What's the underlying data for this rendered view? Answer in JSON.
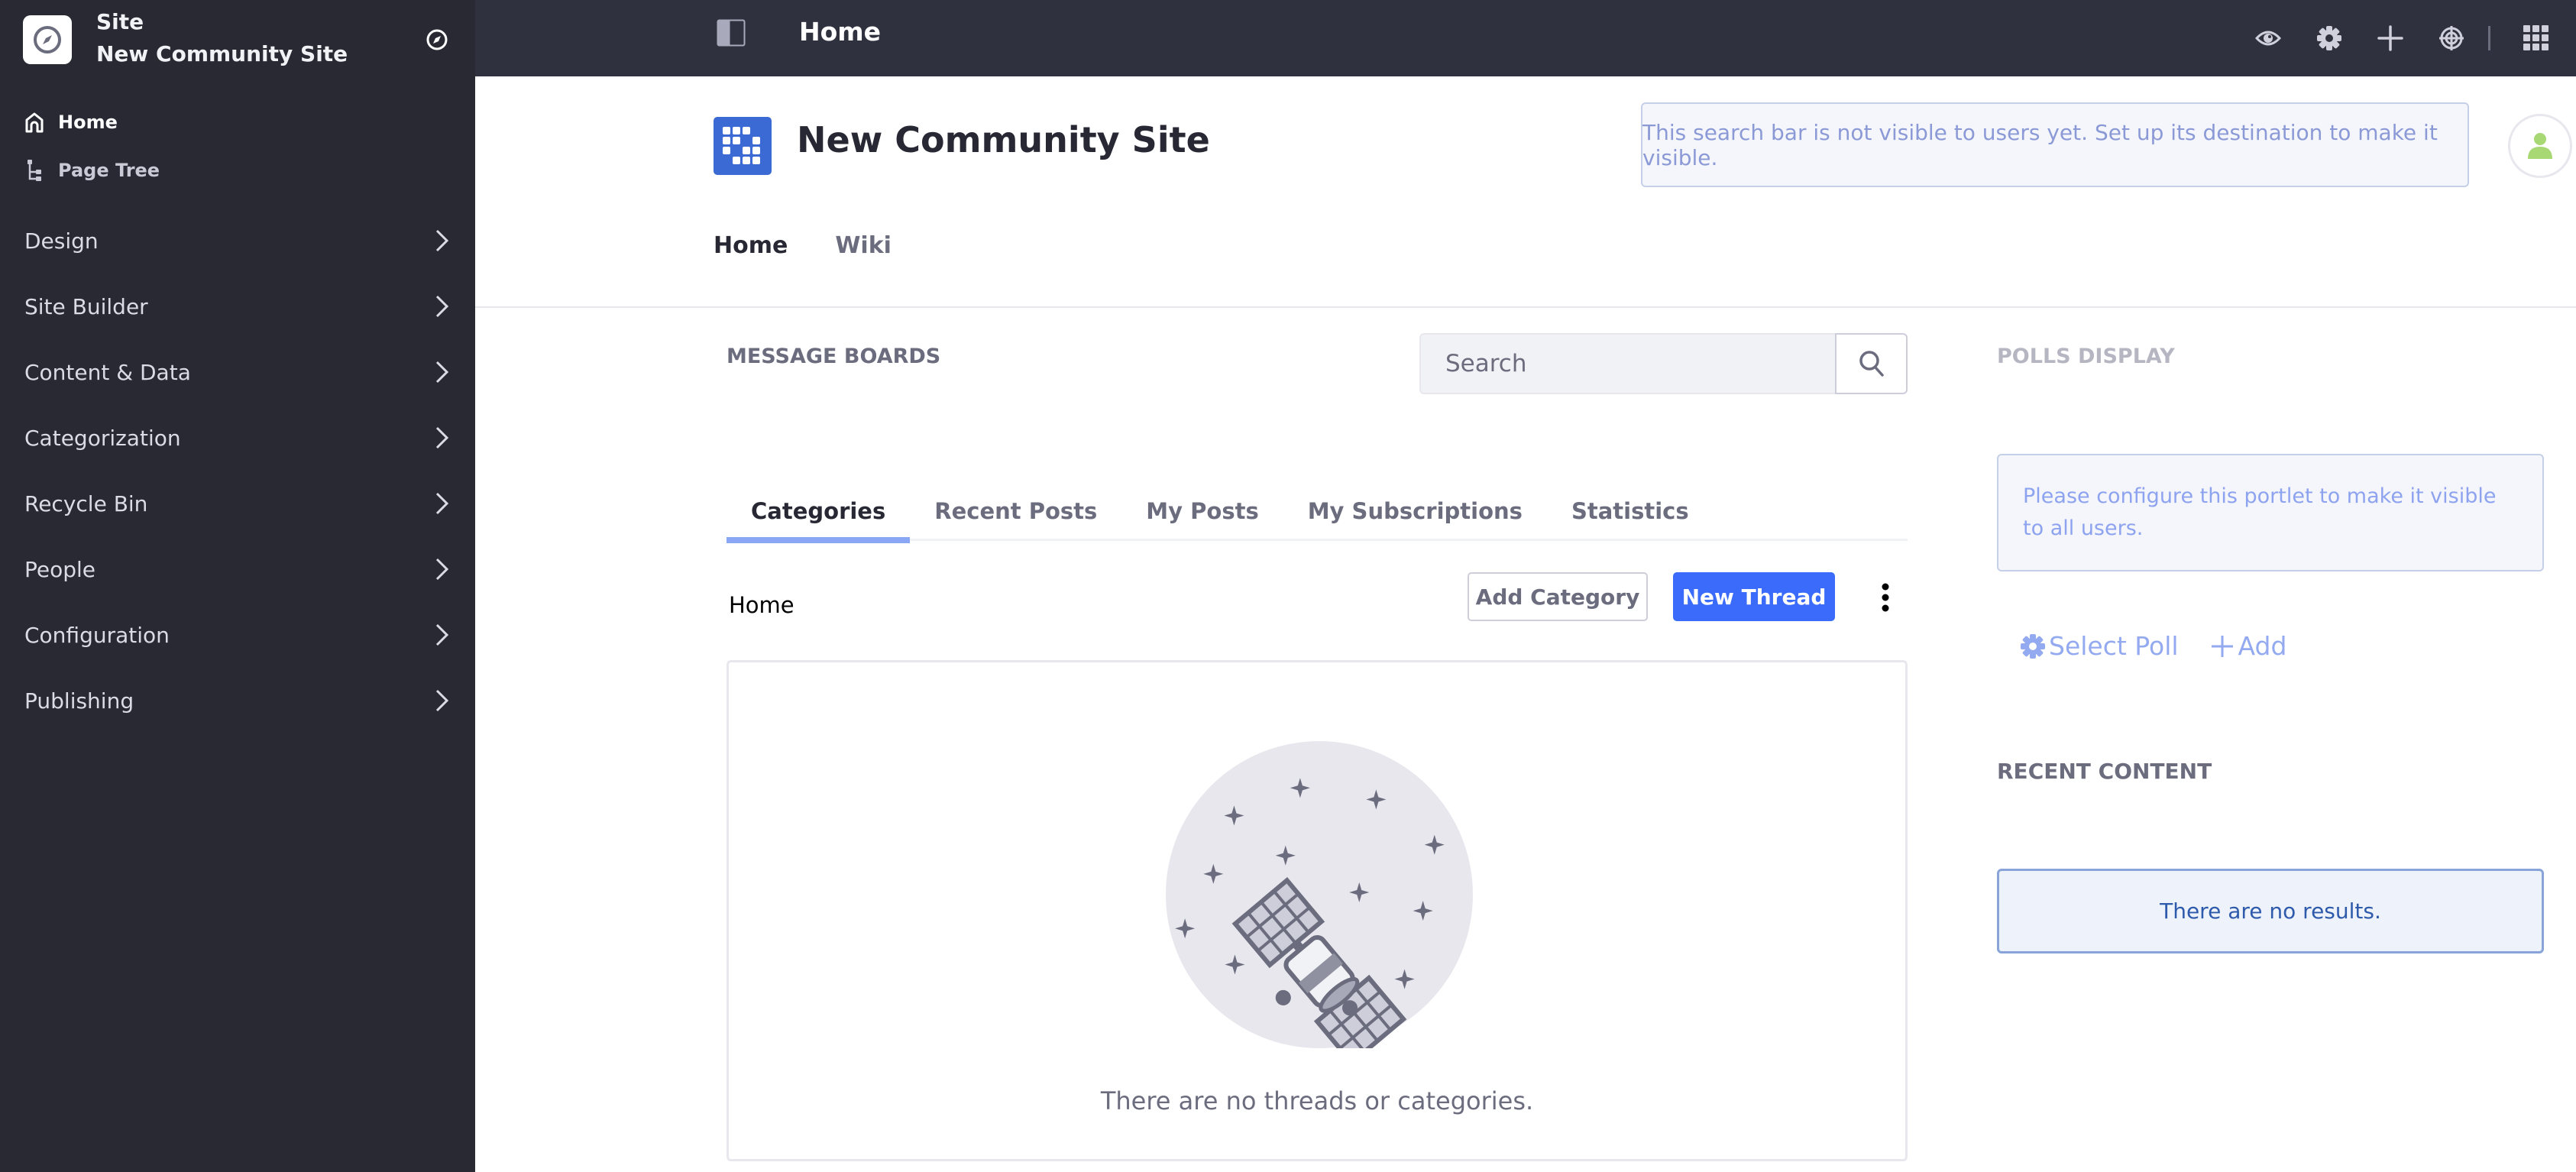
{
  "sidebar": {
    "site_label": "Site",
    "site_name": "New Community Site",
    "quick_links": [
      {
        "label": "Home",
        "icon": "home-icon"
      },
      {
        "label": "Page Tree",
        "icon": "page-tree-icon"
      }
    ],
    "items": [
      {
        "label": "Design"
      },
      {
        "label": "Site Builder"
      },
      {
        "label": "Content & Data"
      },
      {
        "label": "Categorization"
      },
      {
        "label": "Recycle Bin"
      },
      {
        "label": "People"
      },
      {
        "label": "Configuration"
      },
      {
        "label": "Publishing"
      }
    ]
  },
  "topbar": {
    "title": "Home",
    "icons": [
      "preview-eye-icon",
      "settings-gear-icon",
      "add-plus-icon",
      "simulation-target-icon",
      "applications-menu-icon"
    ]
  },
  "site": {
    "title": "New Community Site",
    "search_notice": "This search bar is not visible to users yet. Set up its destination to make it visible.",
    "nav": [
      {
        "label": "Home",
        "active": true
      },
      {
        "label": "Wiki",
        "active": false
      }
    ]
  },
  "message_boards": {
    "title": "MESSAGE BOARDS",
    "search_placeholder": "Search",
    "tabs": [
      {
        "label": "Categories",
        "active": true
      },
      {
        "label": "Recent Posts"
      },
      {
        "label": "My Posts"
      },
      {
        "label": "My Subscriptions"
      },
      {
        "label": "Statistics"
      }
    ],
    "breadcrumb": "Home",
    "add_category_label": "Add Category",
    "new_thread_label": "New Thread",
    "empty_text": "There are no threads or categories."
  },
  "polls": {
    "title": "POLLS DISPLAY",
    "notice": "Please configure this portlet to make it visible to all users.",
    "select_poll_label": "Select Poll",
    "add_label": "Add"
  },
  "recent_content": {
    "title": "RECENT CONTENT",
    "empty_text": "There are no results."
  },
  "colors": {
    "sidebar_bg": "#282933",
    "topbar_bg": "#30313f",
    "primary": "#3a6bfa",
    "site_logo": "#3b6ad5",
    "avatar_accent": "#a7d873"
  }
}
